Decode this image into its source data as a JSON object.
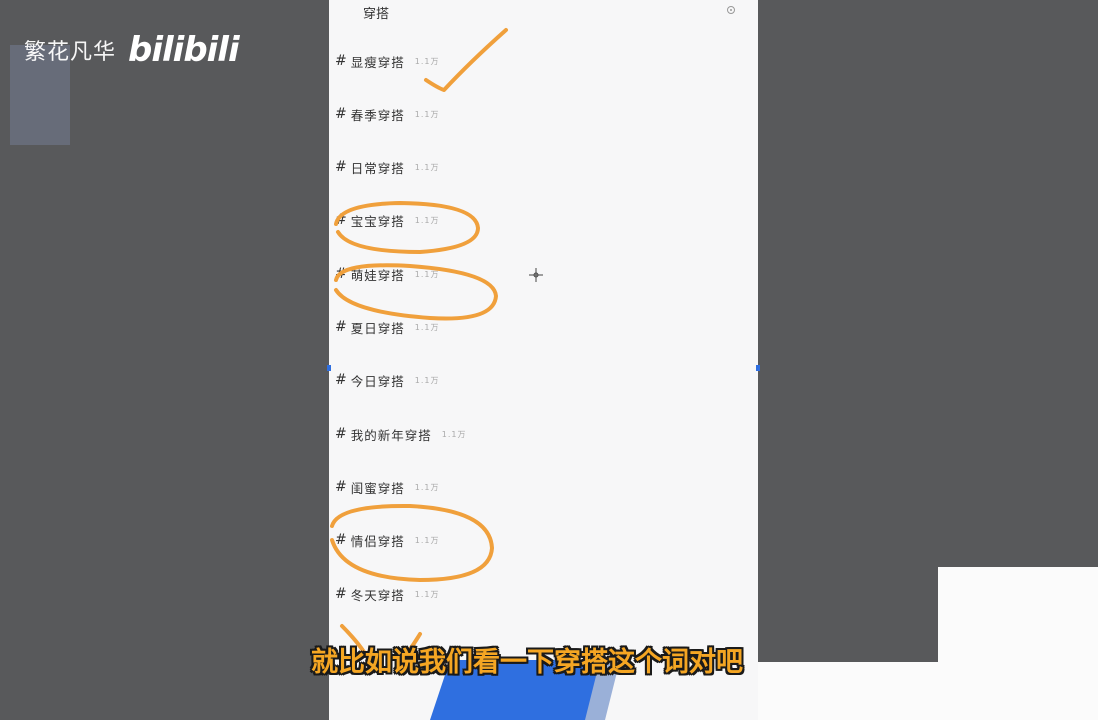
{
  "watermark": {
    "cn_text": "繁花凡华",
    "logo_text": "bilibili"
  },
  "phone": {
    "header_title": "穿搭",
    "header_icon": "settings-icon",
    "tags": [
      {
        "hash": "#",
        "name": "显瘦穿搭",
        "count": "1.1万"
      },
      {
        "hash": "#",
        "name": "春季穿搭",
        "count": "1.1万"
      },
      {
        "hash": "#",
        "name": "日常穿搭",
        "count": "1.1万"
      },
      {
        "hash": "#",
        "name": "宝宝穿搭",
        "count": "1.1万"
      },
      {
        "hash": "#",
        "name": "萌娃穿搭",
        "count": "1.1万"
      },
      {
        "hash": "#",
        "name": "夏日穿搭",
        "count": "1.1万"
      },
      {
        "hash": "#",
        "name": "今日穿搭",
        "count": "1.1万"
      },
      {
        "hash": "#",
        "name": "我的新年穿搭",
        "count": "1.1万"
      },
      {
        "hash": "#",
        "name": "闺蜜穿搭",
        "count": "1.1万"
      },
      {
        "hash": "#",
        "name": "情侣穿搭",
        "count": "1.1万"
      },
      {
        "hash": "#",
        "name": "冬天穿搭",
        "count": "1.1万"
      }
    ]
  },
  "subtitle": "就比如说我们看一下穿搭这个词对吧",
  "colors": {
    "background": "#58595b",
    "annotation": "#f0a03c",
    "subtitle": "#f5a623",
    "accent_blue": "#2f6fe0"
  }
}
